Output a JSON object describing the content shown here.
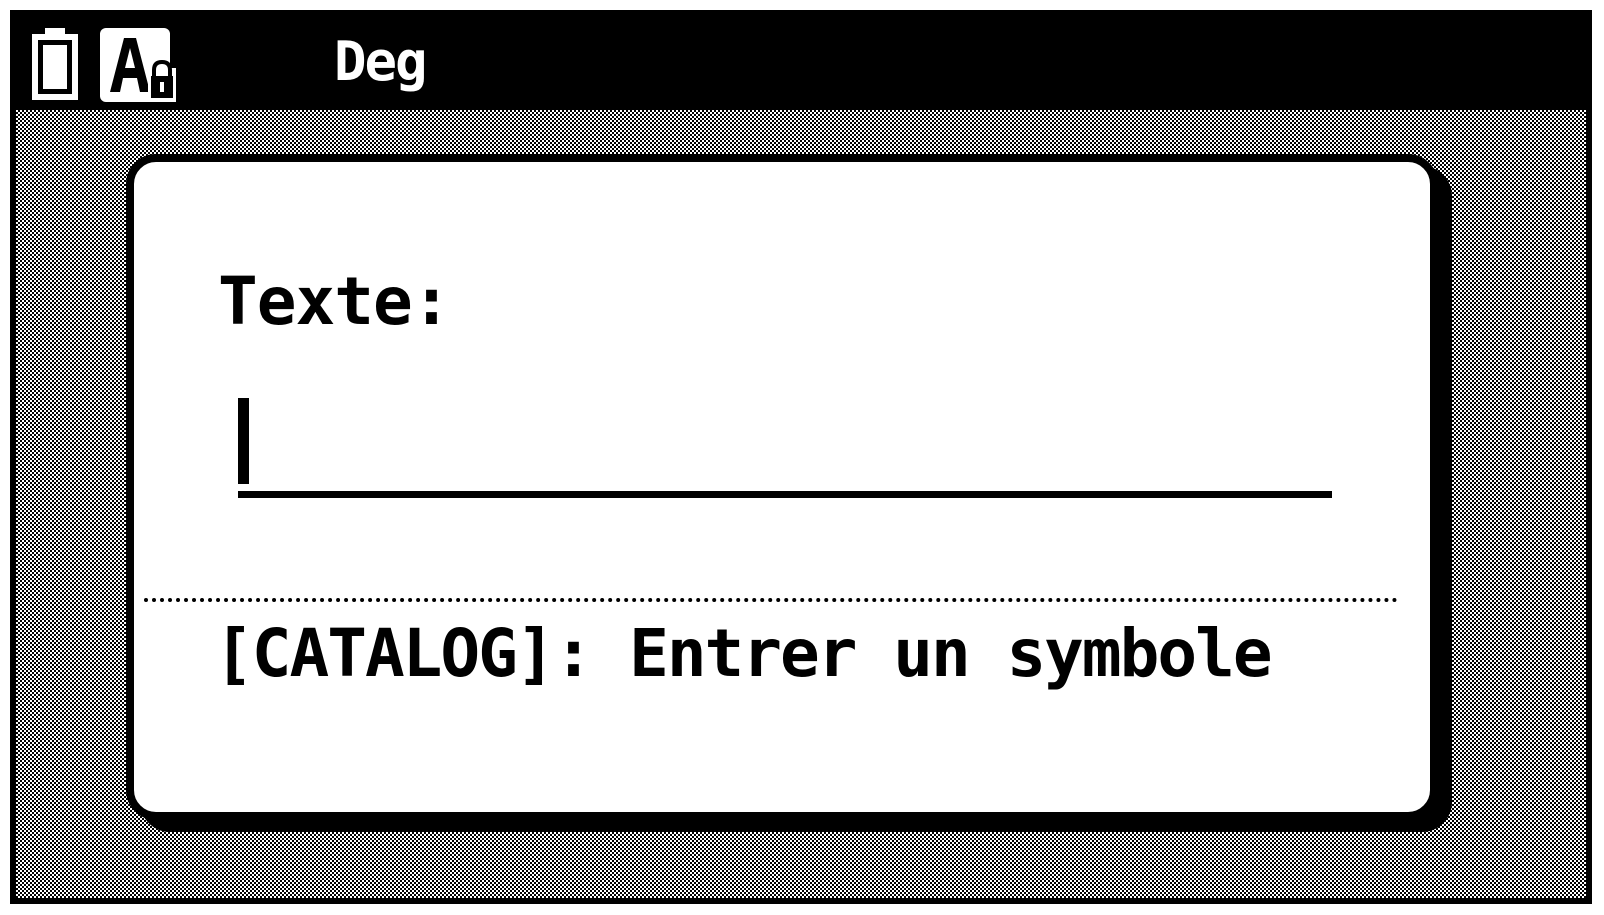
{
  "status_bar": {
    "battery_icon": "battery-icon",
    "input_mode_icon": "alpha-lock-icon",
    "angle_mode": "Deg"
  },
  "dialog": {
    "prompt_label": "Texte:",
    "input_value": "",
    "hint": "[CATALOG]: Entrer un symbole"
  },
  "colors": {
    "foreground": "#000000",
    "background": "#ffffff"
  }
}
